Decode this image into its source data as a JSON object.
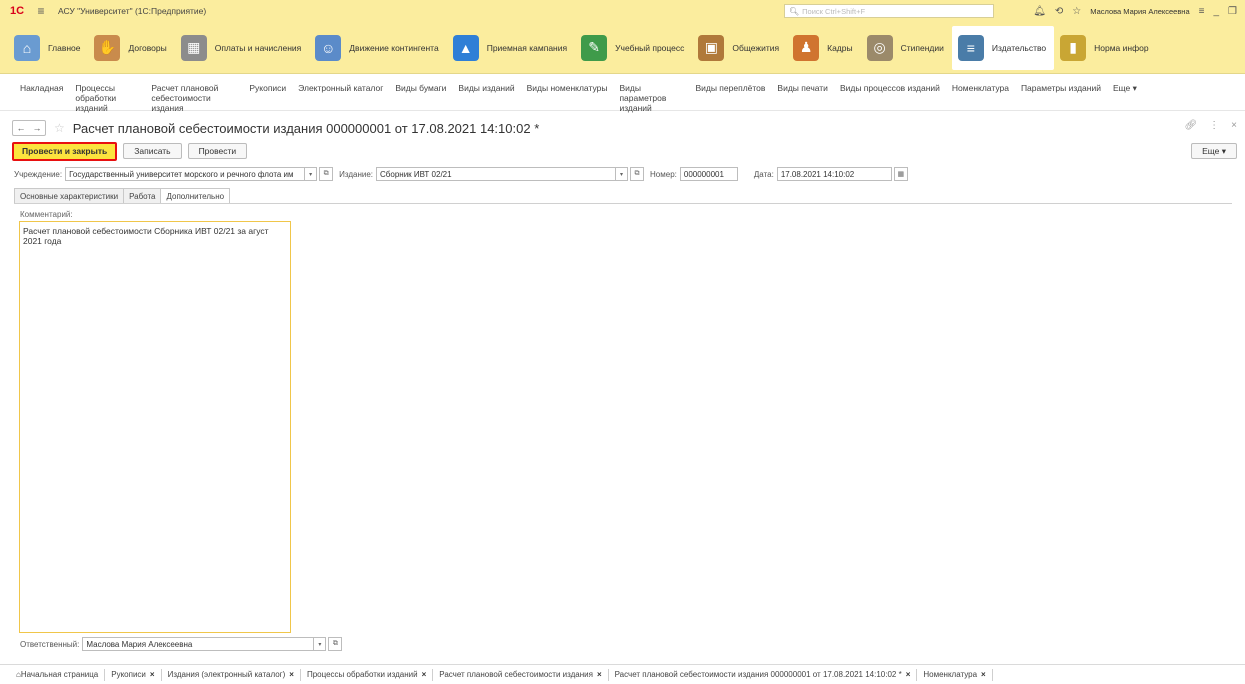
{
  "titlebar": {
    "logo": "1С",
    "app_title": "АСУ \"Университет\" (1С:Предприятие)",
    "search_placeholder": "Поиск Ctrl+Shift+F",
    "user": "Маслова Мария Алексеевна"
  },
  "sections": [
    {
      "label": "Главное",
      "icon": "home-icon",
      "color": "#6a9bd1"
    },
    {
      "label": "Договоры",
      "icon": "handshake-icon",
      "color": "#c98b4c"
    },
    {
      "label": "Оплаты и начисления",
      "icon": "calculator-icon",
      "color": "#8c8c8c"
    },
    {
      "label": "Движение контингента",
      "icon": "person-move-icon",
      "color": "#5b8bc9"
    },
    {
      "label": "Приемная кампания",
      "icon": "chart-up-icon",
      "color": "#2f7fd6"
    },
    {
      "label": "Учебный процесс",
      "icon": "chalkboard-icon",
      "color": "#3f9b4a"
    },
    {
      "label": "Общежития",
      "icon": "building-icon",
      "color": "#b0793a"
    },
    {
      "label": "Кадры",
      "icon": "staff-icon",
      "color": "#d0742f"
    },
    {
      "label": "Стипендии",
      "icon": "coins-icon",
      "color": "#9b8a6a"
    },
    {
      "label": "Издательство",
      "icon": "books-icon",
      "color": "#4a7ca8"
    },
    {
      "label": "Норма инфор",
      "icon": "binder-icon",
      "color": "#c9a634"
    }
  ],
  "active_section": 9,
  "commands": [
    "Накладная",
    "Процессы обработки изданий",
    "Расчет плановой себестоимости издания",
    "Рукописи",
    "Электронный каталог",
    "Виды бумаги",
    "Виды изданий",
    "Виды номенклатуры",
    "Виды параметров изданий",
    "Виды переплётов",
    "Виды печати",
    "Виды процессов изданий",
    "Номенклатура",
    "Параметры изданий",
    "Еще ▾"
  ],
  "document": {
    "title": "Расчет плановой себестоимости издания 000000001 от 17.08.2021 14:10:02 *"
  },
  "toolbar": {
    "post_close": "Провести и закрыть",
    "save": "Записать",
    "post": "Провести",
    "more": "Еще ▾"
  },
  "fields": {
    "institution_label": "Учреждение:",
    "institution_value": "Государственный университет морского и речного флота им",
    "edition_label": "Издание:",
    "edition_value": "Сборник ИВТ 02/21",
    "number_label": "Номер:",
    "number_value": "000000001",
    "date_label": "Дата:",
    "date_value": "17.08.2021 14:10:02"
  },
  "tabs": [
    "Основные характеристики",
    "Работа",
    "Дополнительно"
  ],
  "active_tab": 2,
  "comment": {
    "label": "Комментарий:",
    "value": "Расчет плановой себестоимости Сборника ИВТ 02/21 за агуст\n2021 года"
  },
  "responsible": {
    "label": "Ответственный:",
    "value": "Маслова Мария Алексеевна"
  },
  "bottom_tabs": [
    "Начальная страница",
    "Рукописи",
    "Издания (электронный каталог)",
    "Процессы обработки изданий",
    "Расчет плановой себестоимости издания",
    "Расчет плановой себестоимости издания 000000001 от 17.08.2021 14:10:02 *",
    "Номенклатура"
  ]
}
